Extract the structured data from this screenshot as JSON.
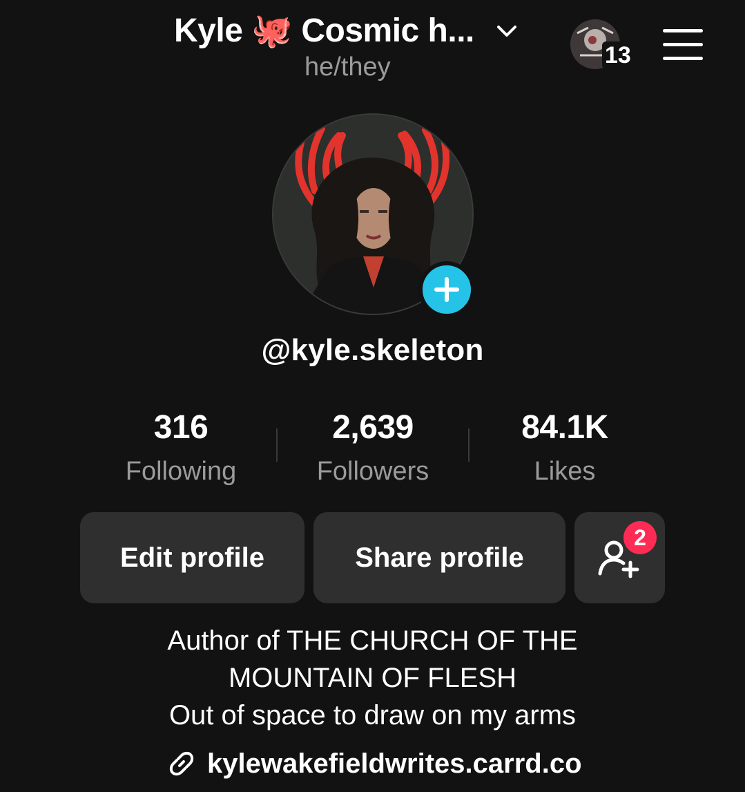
{
  "header": {
    "display_name": "Kyle 🐙 Cosmic h...",
    "pronouns": "he/they",
    "story_count": "13"
  },
  "profile": {
    "username": "@kyle.skeleton"
  },
  "stats": [
    {
      "value": "316",
      "label": "Following"
    },
    {
      "value": "2,639",
      "label": "Followers"
    },
    {
      "value": "84.1K",
      "label": "Likes"
    }
  ],
  "actions": {
    "edit_profile": "Edit profile",
    "share_profile": "Share profile",
    "add_friends_badge": "2"
  },
  "bio": {
    "line1": "Author of THE CHURCH OF THE",
    "line2": "MOUNTAIN OF FLESH",
    "line3": "Out of space to draw on my arms"
  },
  "link": {
    "url": "kylewakefieldwrites.carrd.co"
  },
  "colors": {
    "background": "#121212",
    "button": "#2f2f2f",
    "accent_cyan": "#25c3e8",
    "badge_red": "#fe2c55",
    "muted_text": "#9b9b9b"
  }
}
